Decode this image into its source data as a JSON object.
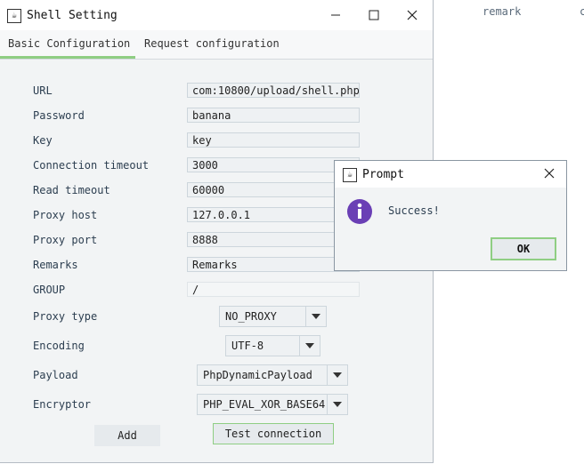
{
  "background": {
    "column_remark": "remark",
    "column_partial": "c"
  },
  "window": {
    "title": "Shell Setting",
    "tabs": [
      "Basic Configuration",
      "Request configuration"
    ]
  },
  "form": {
    "url": {
      "label": "URL",
      "value": "com:10800/upload/shell.php"
    },
    "password": {
      "label": "Password",
      "value": "banana"
    },
    "key": {
      "label": "Key",
      "value": "key"
    },
    "conn_timeout": {
      "label": "Connection timeout",
      "value": "3000"
    },
    "read_timeout": {
      "label": "Read timeout",
      "value": "60000"
    },
    "proxy_host": {
      "label": "Proxy host",
      "value": "127.0.0.1"
    },
    "proxy_port": {
      "label": "Proxy port",
      "value": "8888"
    },
    "remarks": {
      "label": "Remarks",
      "value": "Remarks"
    },
    "group": {
      "label": "GROUP",
      "value": "/"
    },
    "proxy_type": {
      "label": "Proxy type",
      "value": "NO_PROXY"
    },
    "encoding": {
      "label": "Encoding",
      "value": "UTF-8"
    },
    "payload": {
      "label": "Payload",
      "value": "PhpDynamicPayload"
    },
    "encryptor": {
      "label": "Encryptor",
      "value": "PHP_EVAL_XOR_BASE64"
    },
    "add_button": "Add",
    "test_button": "Test connection"
  },
  "prompt": {
    "title": "Prompt",
    "message": "Success!",
    "ok_button": "OK"
  },
  "colors": {
    "accent_green": "#8fce83",
    "info_purple": "#6a3fb5"
  },
  "icons": [
    "java-app-icon",
    "minimize-icon",
    "maximize-icon",
    "close-icon",
    "chevron-down-icon",
    "info-icon"
  ]
}
